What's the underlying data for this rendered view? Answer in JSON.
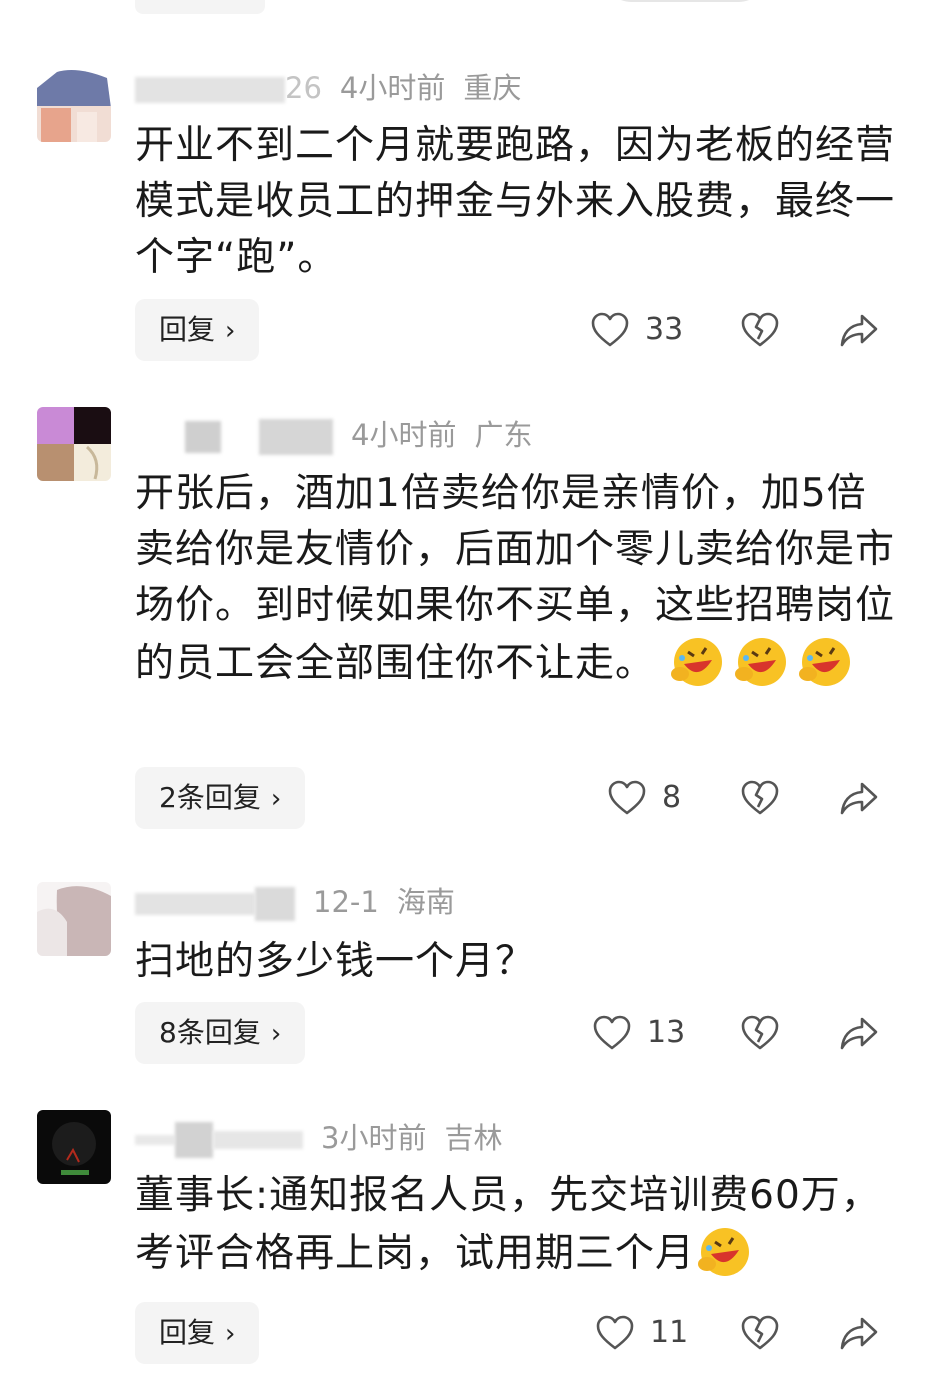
{
  "comments": [
    {
      "name": "",
      "name_tail": "26",
      "time": "4小时前",
      "location": "重庆",
      "text": "开业不到二个月就要跑路，因为老板的经营模式是收员工的押金与外来入股费，最终一个字“跑”。",
      "reply_label": "回复",
      "likes": "33"
    },
    {
      "name": "",
      "time": "4小时前",
      "location": "广东",
      "text": "开张后，酒加1倍卖给你是亲情价，加5倍卖给你是友情价，后面加个零儿卖给你是市场价。到时候如果你不买单，这些招聘岗位的员工会全部围住你不让走。",
      "reply_label": "2条回复",
      "likes": "8"
    },
    {
      "name": "",
      "time": "12-1",
      "location": "海南",
      "text": "扫地的多少钱一个月？",
      "reply_label": "8条回复",
      "likes": "13"
    },
    {
      "name": "",
      "time": "3小时前",
      "location": "吉林",
      "text": "董事长:通知报名人员，先交培训费60万，考评合格再上岗，试用期三个月",
      "reply_label": "回复",
      "likes": "11"
    }
  ],
  "icons": {
    "like": "heart-outline-icon",
    "dislike": "broken-heart-icon",
    "share": "share-arrow-icon",
    "emoji": "rofl-emoji-icon"
  },
  "colors": {
    "meta": "#9a9a9a",
    "text": "#1a1a1a",
    "reply_bg": "#f4f4f4",
    "icon": "#555555"
  }
}
